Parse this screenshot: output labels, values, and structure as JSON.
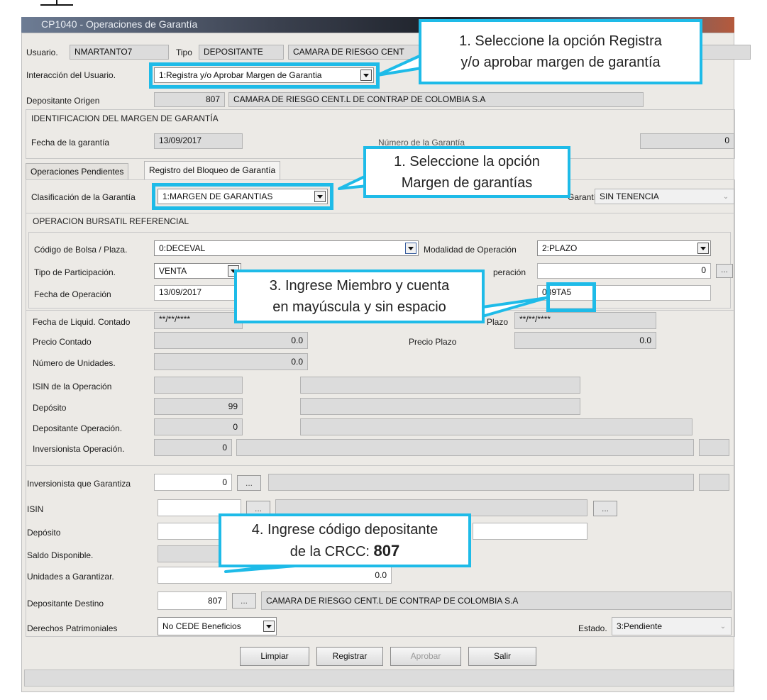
{
  "window": {
    "title": "CP1040 - Operaciones de Garantía"
  },
  "header": {
    "usuario_label": "Usuario.",
    "usuario_value": "NMARTANTO7",
    "tipo_label": "Tipo",
    "tipo_value": "DEPOSITANTE",
    "entity_value": "CAMARA DE RIESGO CENT"
  },
  "interaccion": {
    "label": "Interacción del Usuario.",
    "value": "1:Registra y/o Aprobar Margen de Garantia"
  },
  "origen": {
    "label": "Depositante Origen",
    "code": "807",
    "name": "CAMARA DE RIESGO CENT.L DE CONTRAP DE COLOMBIA S.A"
  },
  "identificacion": {
    "title": "IDENTIFICACION DEL MARGEN DE GARANTÍA",
    "fecha_label": "Fecha de la garantía",
    "fecha_value": "13/09/2017",
    "numero_label": "Número  de la Garantía",
    "numero_value": "0"
  },
  "tabs": [
    {
      "label": "Operaciones Pendientes"
    },
    {
      "label": "Registro del Bloqueo de Garantía"
    }
  ],
  "clasificacion": {
    "label": "Clasificación de la Garantía",
    "value": "1:MARGEN DE GARANTIAS",
    "tenencia_label": "Garantía",
    "tenencia_value": "SIN TENENCIA"
  },
  "operacion": {
    "title": "OPERACION BURSATIL REFERENCIAL",
    "codigo_label": "Código de Bolsa / Plaza.",
    "codigo_value": "0:DECEVAL",
    "modalidad_label": "Modalidad de Operación",
    "modalidad_value": "2:PLAZO",
    "tipo_label": "Tipo de Participación.",
    "tipo_value": "VENTA",
    "num_op_label": "peración",
    "num_op_value": "0",
    "fecha_label": "Fecha de Operación",
    "fecha_value": "13/09/2017",
    "cuenta_value": "039TA5"
  },
  "liquidacion": {
    "fecha_label": "Fecha de Liquid. Contado",
    "fecha_value": "**/**/****",
    "plazo_label": "Plazo",
    "plazo_value": "**/**/****",
    "precio_contado_label": "Precio Contado",
    "precio_contado_value": "0.0",
    "precio_plazo_label": "Precio Plazo",
    "precio_plazo_value": "0.0",
    "unidades_label": "Número  de Unidades.",
    "unidades_value": "0.0",
    "isin_label": "ISIN de la Operación",
    "deposito_label": "Depósito",
    "deposito_value": "99",
    "dep_op_label": "Depositante Operación.",
    "dep_op_value": "0",
    "inv_op_label": "Inversionista Operación.",
    "inv_op_value": "0"
  },
  "garantia": {
    "inversionista_label": "Inversionista que Garantiza",
    "inversionista_value": "0",
    "isin_label": "ISIN",
    "deposito_label": "Depósito",
    "saldo_label": "Saldo Disponible.",
    "unidades_label": "Unidades a Garantizar.",
    "unidades_value": "0.0",
    "destino_label": "Depositante Destino",
    "destino_code": "807",
    "destino_name": "CAMARA DE RIESGO CENT.L DE CONTRAP DE COLOMBIA S.A",
    "derechos_label": "Derechos Patrimoniales",
    "derechos_value": "No CEDE Beneficios",
    "estado_label": "Estado.",
    "estado_value": "3:Pendiente"
  },
  "buttons": {
    "limpiar": "Limpiar",
    "registrar": "Registrar",
    "aprobar": "Aprobar",
    "salir": "Salir",
    "ellipsis": "..."
  },
  "callouts": {
    "c1_line1": "1. Seleccione la opción Registra",
    "c1_line2": "y/o aprobar margen de garantía",
    "c2_line1": "1. Seleccione la opción",
    "c2_line2": "Margen de garantías",
    "c3_line1": "3. Ingrese Miembro y cuenta",
    "c3_line2": "en mayúscula y sin espacio",
    "c4_line1": "4. Ingrese código depositante",
    "c4_line2_prefix": "de la CRCC:",
    "c4_line2_code": "807"
  },
  "colors": {
    "callout_border": "#1ebbe8",
    "panel_bg": "#eceae6"
  }
}
